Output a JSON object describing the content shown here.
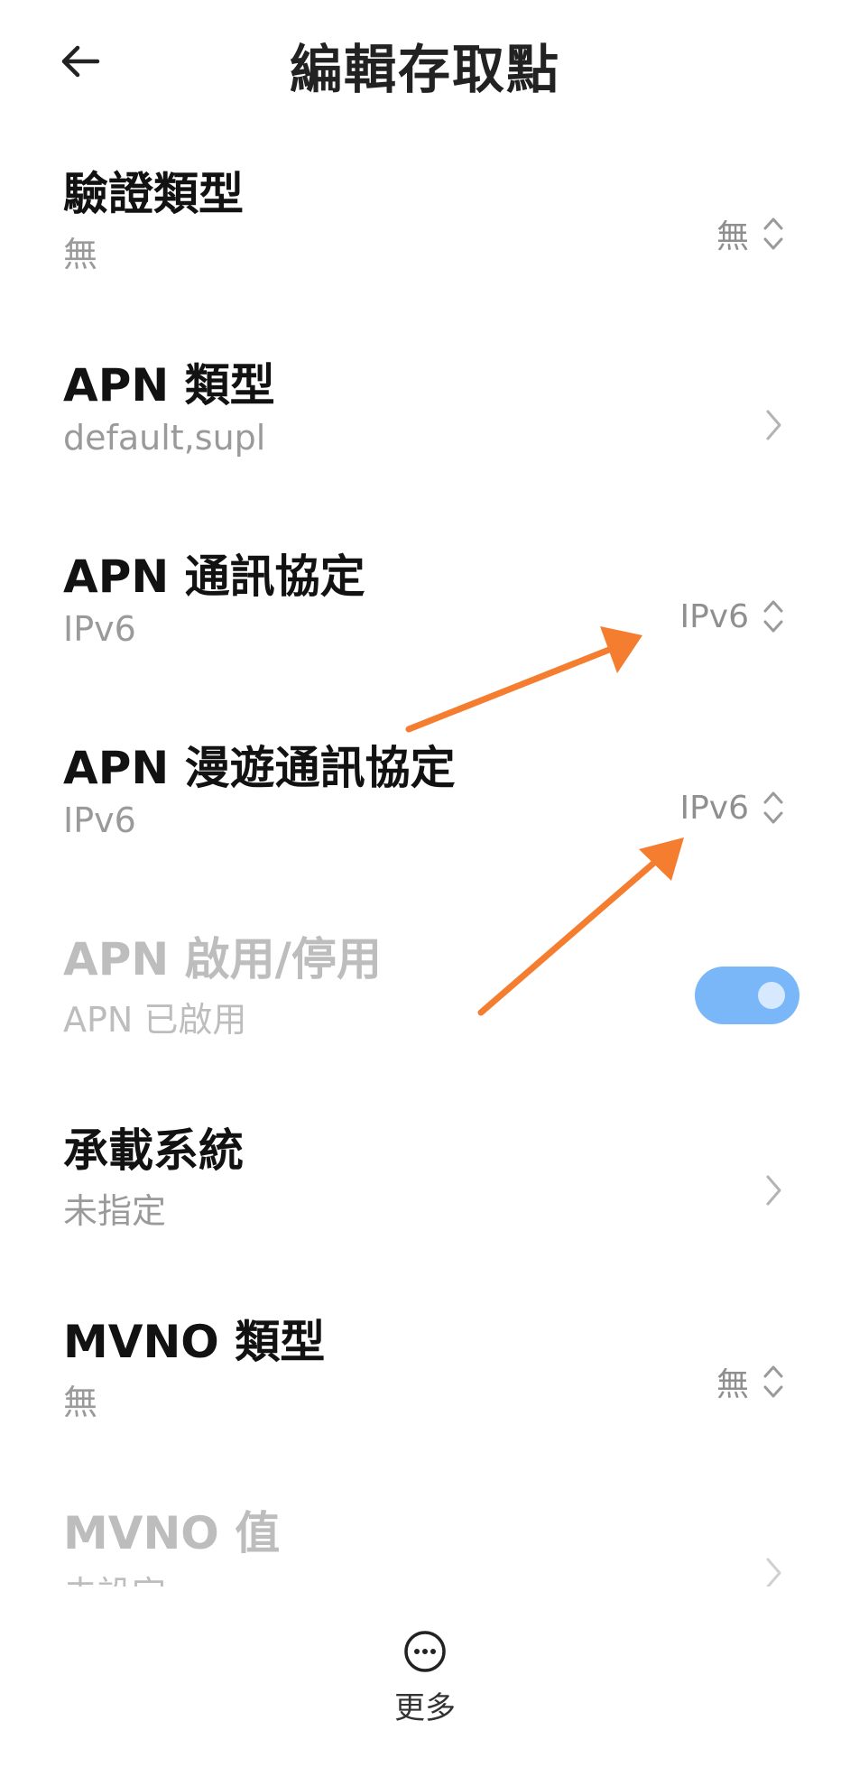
{
  "header": {
    "title": "編輯存取點"
  },
  "rows": [
    {
      "title": "驗證類型",
      "sub": "無",
      "value": "無"
    },
    {
      "title": "APN 類型",
      "sub": "default,supl"
    },
    {
      "title": "APN 通訊協定",
      "sub": "IPv6",
      "value": "IPv6"
    },
    {
      "title": "APN 漫遊通訊協定",
      "sub": "IPv6",
      "value": "IPv6"
    },
    {
      "title": "APN 啟用/停用",
      "sub": "APN 已啟用",
      "toggle_on": true
    },
    {
      "title": "承載系統",
      "sub": "未指定"
    },
    {
      "title": "MVNO 類型",
      "sub": "無",
      "value": "無"
    },
    {
      "title": "MVNO 值",
      "sub": "未設定"
    }
  ],
  "footer": {
    "more_label": "更多"
  },
  "colors": {
    "accent": "#79b7f8",
    "annotation_arrow": "#f47d2f"
  }
}
